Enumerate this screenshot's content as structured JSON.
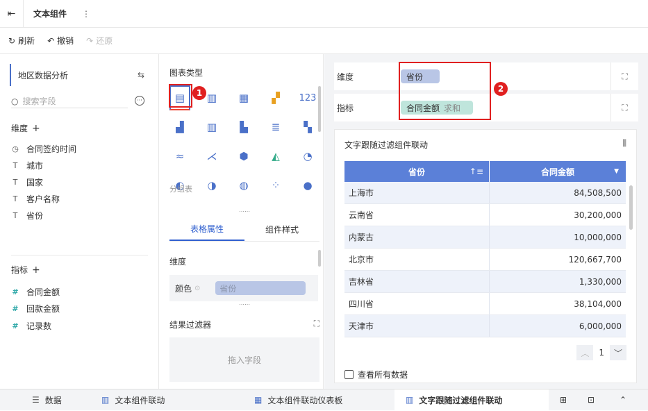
{
  "header": {
    "title": "文本组件",
    "more_icon": "more-vertical-icon",
    "back_icon": "exit-icon"
  },
  "toolbar": {
    "refresh": "刷新",
    "undo": "撤销",
    "redo": "还原"
  },
  "left_panel": {
    "dataset": "地区数据分析",
    "search_placeholder": "搜索字段",
    "dimension_title": "维度",
    "dimensions": [
      "合同签约时间",
      "城市",
      "国家",
      "客户名称",
      "省份"
    ],
    "measure_title": "指标",
    "measures": [
      "合同金额",
      "回款金额",
      "记录数"
    ]
  },
  "mid_panel": {
    "chart_type_title": "图表类型",
    "group_table_label": "分组表",
    "badge1": "1",
    "tabs": [
      "表格属性",
      "组件样式"
    ],
    "dimension_label": "维度",
    "color_label": "颜色",
    "color_field": "省份",
    "result_filter": "结果过滤器",
    "drop_hint": "拖入字段"
  },
  "right_panel": {
    "dimension_label": "维度",
    "dimension_field": "省份",
    "measure_label": "指标",
    "measure_field": "合同金额",
    "measure_agg": "求和",
    "badge2": "2",
    "widget_title": "文字跟随过滤组件联动",
    "col1": "省份",
    "col2": "合同金额",
    "rows": [
      [
        "上海市",
        "84,508,500"
      ],
      [
        "云南省",
        "30,200,000"
      ],
      [
        "内蒙古",
        "10,000,000"
      ],
      [
        "北京市",
        "120,667,700"
      ],
      [
        "吉林省",
        "1,330,000"
      ],
      [
        "四川省",
        "38,104,000"
      ],
      [
        "天津市",
        "6,000,000"
      ]
    ],
    "page": "1",
    "view_all": "查看所有数据"
  },
  "bottom_tabs": [
    "数据",
    "文本组件联动",
    "文本组件联动仪表板",
    "文字跟随过滤组件联动"
  ],
  "colors": {
    "accent": "#4a70c8",
    "header": "#5b80d8",
    "badge": "#e02020"
  }
}
